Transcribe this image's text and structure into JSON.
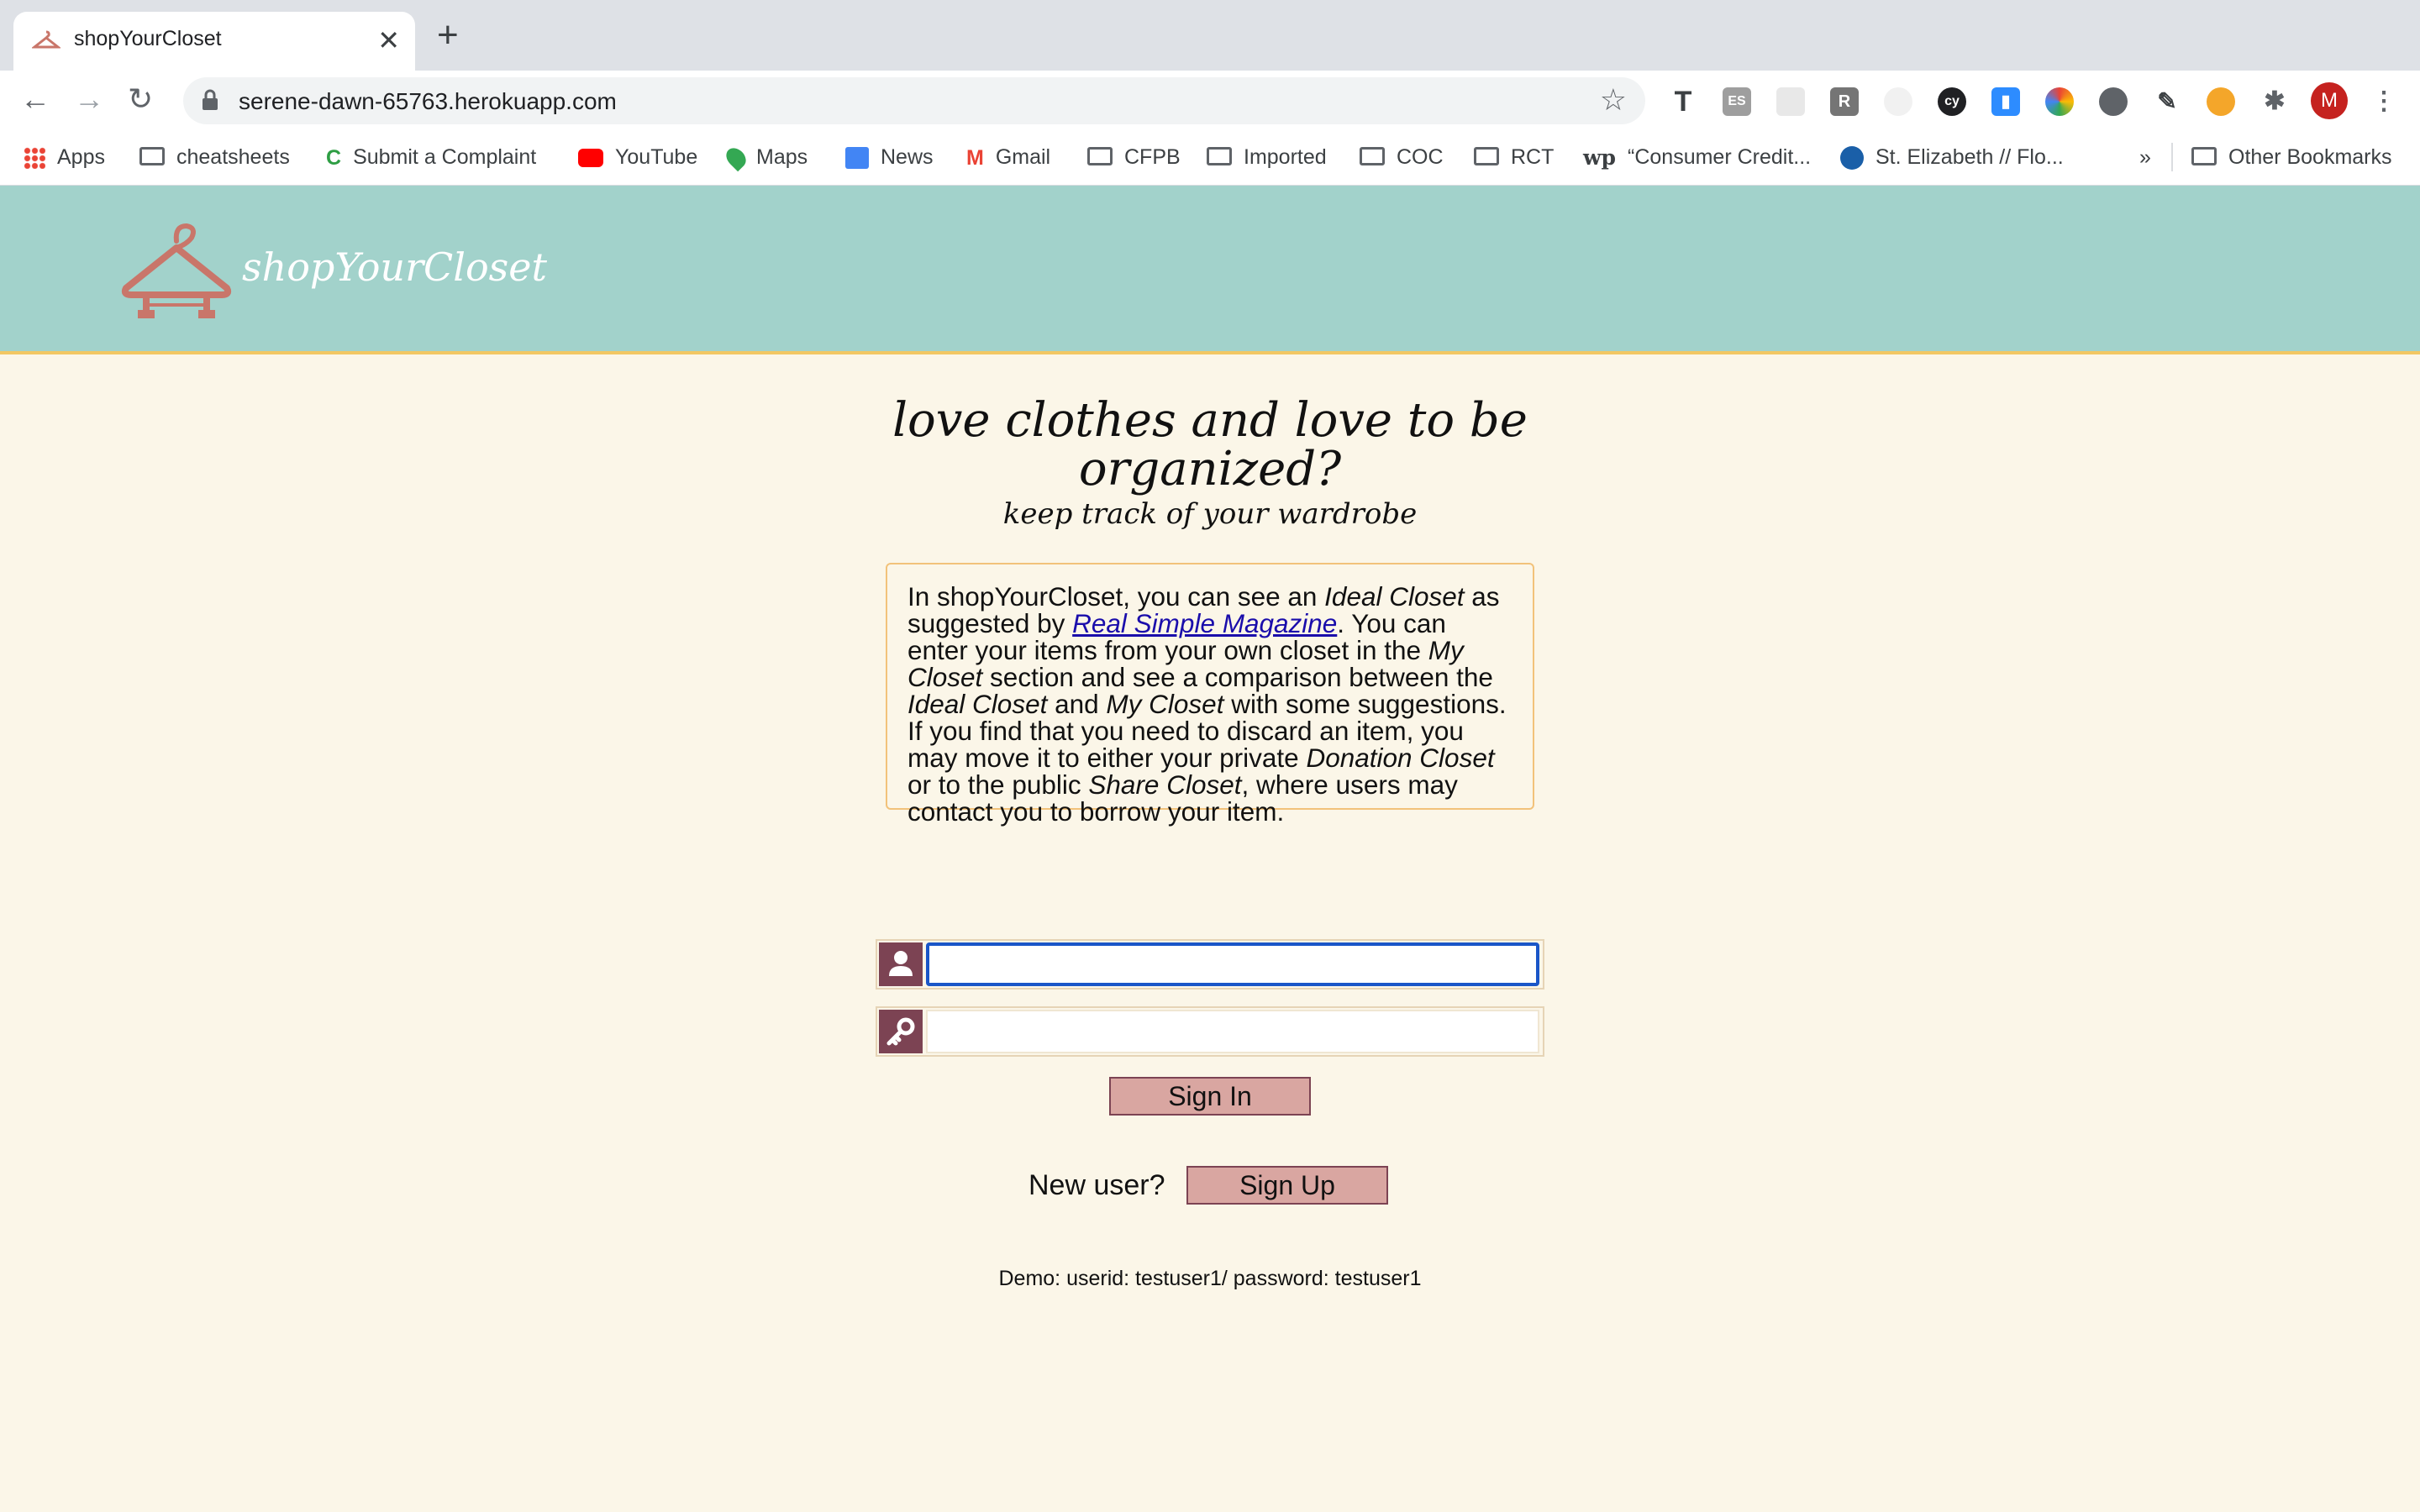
{
  "browser": {
    "tab": {
      "title": "shopYourCloset"
    },
    "url": "serene-dawn-65763.herokuapp.com",
    "bookmarks": [
      {
        "label": "Apps",
        "icon": "apps-grid-icon"
      },
      {
        "label": "cheatsheets",
        "icon": "folder-icon"
      },
      {
        "label": "Submit a Complaint",
        "icon": "cfpb-icon"
      },
      {
        "label": "YouTube",
        "icon": "youtube-icon"
      },
      {
        "label": "Maps",
        "icon": "maps-icon"
      },
      {
        "label": "News",
        "icon": "news-icon"
      },
      {
        "label": "Gmail",
        "icon": "gmail-icon"
      },
      {
        "label": "CFPB",
        "icon": "folder-icon"
      },
      {
        "label": "Imported",
        "icon": "folder-icon"
      },
      {
        "label": "COC",
        "icon": "folder-icon"
      },
      {
        "label": "RCT",
        "icon": "folder-icon"
      },
      {
        "label": "“Consumer Credit...",
        "icon": "washington-post-icon"
      },
      {
        "label": "St. Elizabeth // Flo...",
        "icon": "st-elizabeth-icon"
      }
    ],
    "more_bookmarks": "»",
    "other_bookmarks": "Other Bookmarks",
    "profile_initial": "M"
  },
  "site": {
    "logo_text": "shopYourCloset",
    "headline_1": "love clothes and love to be",
    "headline_2": "organized?",
    "subheadline": "keep track of your wardrobe",
    "intro": {
      "p1": "In shopYourCloset, you can see an ",
      "ideal": "Ideal Closet",
      "p2": " as suggested by ",
      "magazine": "Real Simple Magazine",
      "p3": ". You can enter your items from your own closet in the ",
      "my": "My Closet",
      "p4": " section and see a comparison between the ",
      "ideal2": "Ideal Closet",
      "p5": " and ",
      "my2": "My Closet",
      "p6": " with some suggestions. If you find that you need to discard an item, you may move it to either your private ",
      "donation": "Donation Closet",
      "p7": " or to the public ",
      "share": "Share Closet",
      "p8": ", where users may contact you to borrow your item."
    },
    "login": {
      "userid_value": "",
      "password_value": "",
      "signin_label": "Sign In",
      "new_user_label": "New user?",
      "signup_label": "Sign Up"
    },
    "demo_text": "Demo: userid: testuser1/ password: testuser1"
  },
  "colors": {
    "header_bg": "#a2d2cb",
    "page_bg": "#fbf6e8",
    "accent": "#7c4353",
    "button_bg": "#d9a6a1",
    "logo": "#c9766a"
  }
}
